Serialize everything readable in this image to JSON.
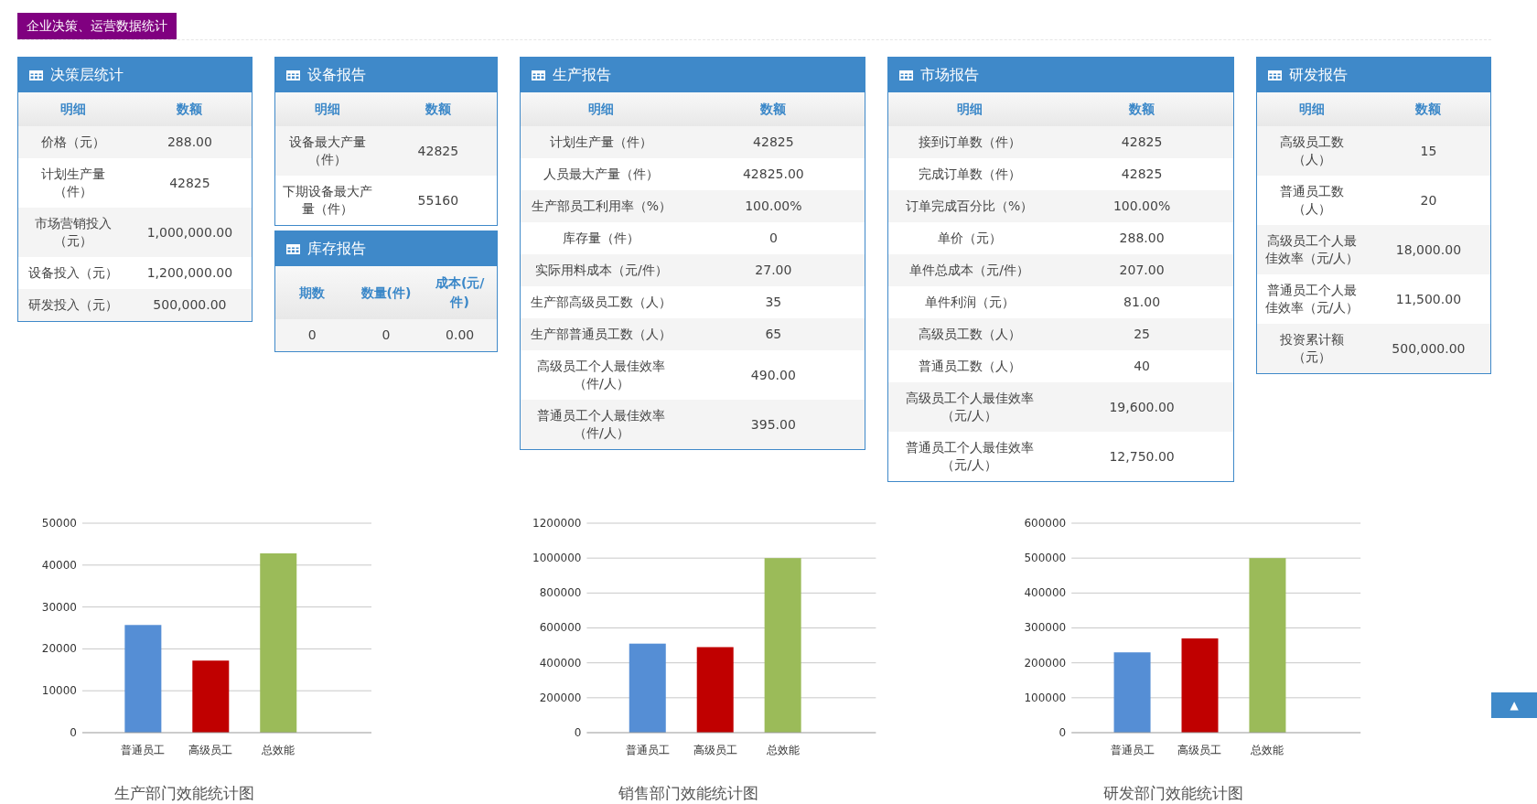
{
  "page_title": "企业决策、运营数据统计",
  "columns": [
    {
      "panels": [
        {
          "title": "决策层统计",
          "headers": [
            "明细",
            "数额"
          ],
          "rows": [
            [
              "价格（元）",
              "288.00"
            ],
            [
              "计划生产量（件）",
              "42825"
            ],
            [
              "市场营销投入（元）",
              "1,000,000.00"
            ],
            [
              "设备投入（元）",
              "1,200,000.00"
            ],
            [
              "研发投入（元）",
              "500,000.00"
            ]
          ]
        }
      ]
    },
    {
      "panels": [
        {
          "title": "设备报告",
          "headers": [
            "明细",
            "数额"
          ],
          "rows": [
            [
              "设备最大产量（件）",
              "42825"
            ],
            [
              "下期设备最大产量（件）",
              "55160"
            ]
          ]
        },
        {
          "title": "库存报告",
          "headers": [
            "期数",
            "数量(件)",
            "成本(元/件)"
          ],
          "rows": [
            [
              "0",
              "0",
              "0.00"
            ]
          ]
        }
      ]
    },
    {
      "panels": [
        {
          "title": "生产报告",
          "headers": [
            "明细",
            "数额"
          ],
          "rows": [
            [
              "计划生产量（件）",
              "42825"
            ],
            [
              "人员最大产量（件）",
              "42825.00"
            ],
            [
              "生产部员工利用率（%）",
              "100.00%"
            ],
            [
              "库存量（件）",
              "0"
            ],
            [
              "实际用料成本（元/件）",
              "27.00"
            ],
            [
              "生产部高级员工数（人）",
              "35"
            ],
            [
              "生产部普通员工数（人）",
              "65"
            ],
            [
              "高级员工个人最佳效率（件/人）",
              "490.00"
            ],
            [
              "普通员工个人最佳效率（件/人）",
              "395.00"
            ]
          ]
        }
      ]
    },
    {
      "panels": [
        {
          "title": "市场报告",
          "headers": [
            "明细",
            "数额"
          ],
          "rows": [
            [
              "接到订单数（件）",
              "42825"
            ],
            [
              "完成订单数（件）",
              "42825"
            ],
            [
              "订单完成百分比（%）",
              "100.00%"
            ],
            [
              "单价（元）",
              "288.00"
            ],
            [
              "单件总成本（元/件）",
              "207.00"
            ],
            [
              "单件利润（元）",
              "81.00"
            ],
            [
              "高级员工数（人）",
              "25"
            ],
            [
              "普通员工数（人）",
              "40"
            ],
            [
              "高级员工个人最佳效率（元/人）",
              "19,600.00"
            ],
            [
              "普通员工个人最佳效率（元/人）",
              "12,750.00"
            ]
          ]
        }
      ]
    },
    {
      "panels": [
        {
          "title": "研发报告",
          "headers": [
            "明细",
            "数额"
          ],
          "rows": [
            [
              "高级员工数（人）",
              "15"
            ],
            [
              "普通员工数（人）",
              "20"
            ],
            [
              "高级员工个人最佳效率（元/人）",
              "18,000.00"
            ],
            [
              "普通员工个人最佳效率（元/人）",
              "11,500.00"
            ],
            [
              "投资累计额（元）",
              "500,000.00"
            ]
          ]
        }
      ]
    }
  ],
  "charts": [
    {
      "chart_data": {
        "type": "bar",
        "title": "生产部门效能统计图",
        "categories": [
          "普通员工",
          "高级员工",
          "总效能"
        ],
        "stacked": true,
        "grid": true,
        "ylim": [
          0,
          50000
        ],
        "yticks": [
          0,
          10000,
          20000,
          30000,
          40000,
          50000
        ],
        "series": [
          {
            "color": "#558ed5",
            "values": [
              25700,
              null,
              null
            ]
          },
          {
            "color": "#c00000",
            "values": [
              null,
              17200,
              null
            ]
          },
          {
            "color": "#9bbb59",
            "values": [
              null,
              null,
              42800
            ]
          }
        ]
      }
    },
    {
      "chart_data": {
        "type": "bar",
        "title": "销售部门效能统计图",
        "categories": [
          "普通员工",
          "高级员工",
          "总效能"
        ],
        "stacked": true,
        "grid": true,
        "ylim": [
          0,
          1200000
        ],
        "yticks": [
          0,
          200000,
          400000,
          600000,
          800000,
          1000000,
          1200000
        ],
        "series": [
          {
            "color": "#558ed5",
            "values": [
              510000,
              null,
              null
            ]
          },
          {
            "color": "#c00000",
            "values": [
              null,
              490000,
              null
            ]
          },
          {
            "color": "#9bbb59",
            "values": [
              null,
              null,
              1000000
            ]
          }
        ]
      }
    },
    {
      "chart_data": {
        "type": "bar",
        "title": "研发部门效能统计图",
        "categories": [
          "普通员工",
          "高级员工",
          "总效能"
        ],
        "stacked": true,
        "grid": true,
        "ylim": [
          0,
          600000
        ],
        "yticks": [
          0,
          100000,
          200000,
          300000,
          400000,
          500000,
          600000
        ],
        "series": [
          {
            "color": "#558ed5",
            "values": [
              230000,
              null,
              null
            ]
          },
          {
            "color": "#c00000",
            "values": [
              null,
              270000,
              null
            ]
          },
          {
            "color": "#9bbb59",
            "values": [
              null,
              null,
              500000
            ]
          }
        ]
      }
    }
  ],
  "back_to_top": {
    "label": "▲"
  }
}
